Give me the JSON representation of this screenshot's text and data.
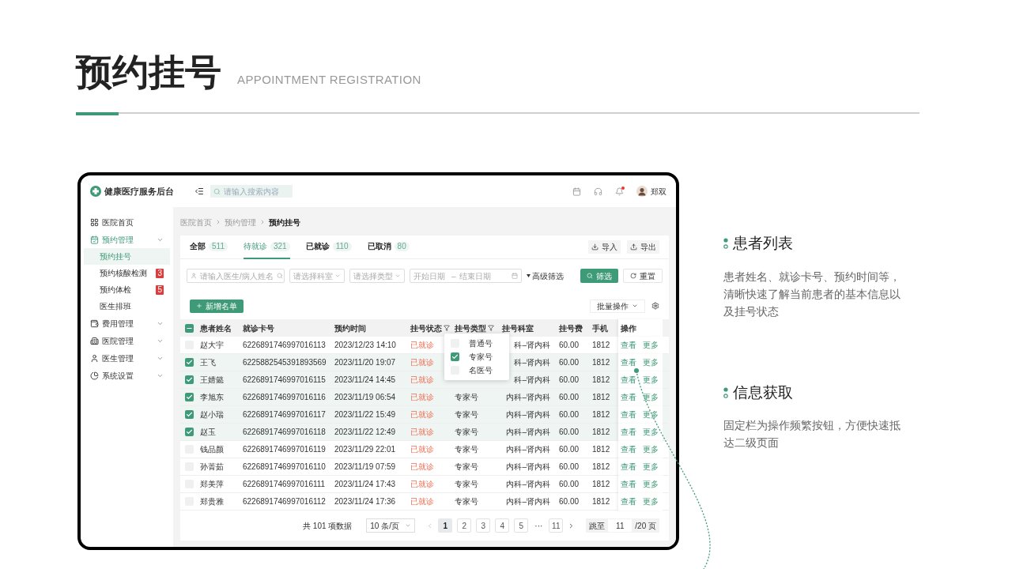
{
  "slide": {
    "title": "预约挂号",
    "subtitle": "APPOINTMENT REGISTRATION"
  },
  "app": {
    "brand": "健康医疗服务后台",
    "search_placeholder": "请输入搜索内容",
    "user": "郑双",
    "notification": true,
    "sidebar": [
      {
        "label": "医院首页",
        "selected": false,
        "expandable": false
      },
      {
        "label": "预约管理",
        "selected": true,
        "expandable": true,
        "children": [
          {
            "label": "预约挂号",
            "selected": true
          },
          {
            "label": "预约核酸检测",
            "selected": false,
            "badge": "3"
          },
          {
            "label": "预约体检",
            "selected": false,
            "badge": "5"
          },
          {
            "label": "医生排班",
            "selected": false
          }
        ]
      },
      {
        "label": "费用管理",
        "selected": false,
        "expandable": true
      },
      {
        "label": "医院管理",
        "selected": false,
        "expandable": true
      },
      {
        "label": "医生管理",
        "selected": false,
        "expandable": true
      },
      {
        "label": "系统设置",
        "selected": false,
        "expandable": true
      }
    ],
    "breadcrumb": [
      "医院首页",
      "预约管理",
      "预约挂号"
    ],
    "tabs": [
      {
        "label": "全部",
        "count": "511",
        "selected": false
      },
      {
        "label": "待就诊",
        "count": "321",
        "selected": true
      },
      {
        "label": "已就诊",
        "count": "110",
        "selected": false
      },
      {
        "label": "已取消",
        "count": "80",
        "selected": false
      }
    ],
    "actions": [
      {
        "label": "导入",
        "kind": "import"
      },
      {
        "label": "导出",
        "kind": "export"
      }
    ],
    "filters": {
      "name_placeholder": "请输入医生/病人姓名",
      "dept_placeholder": "请选择科室",
      "type_placeholder": "请选择类型",
      "start_placeholder": "开始日期",
      "range_separator": "–",
      "end_placeholder": "结束日期",
      "advanced": "高级筛选",
      "search": "筛选",
      "reset": "重置"
    },
    "add_button": "新增名单",
    "batch": "批量操作",
    "table": {
      "select_all_partial": true,
      "columns": [
        {
          "label": "患者姓名",
          "filter": false
        },
        {
          "label": "就诊卡号",
          "filter": false
        },
        {
          "label": "预约时间",
          "filter": false
        },
        {
          "label": "挂号状态",
          "filter": true
        },
        {
          "label": "挂号类型",
          "filter": true
        },
        {
          "label": "挂号科室",
          "filter": false
        },
        {
          "label": "挂号费",
          "filter": false
        },
        {
          "label": "手机",
          "filter": false
        },
        {
          "label": "操作",
          "filter": false
        }
      ],
      "rows": [
        {
          "checked": false,
          "name": "赵大宇",
          "card": "6226891746997016113",
          "time": "2023/12/23 14:10",
          "status": "已就诊",
          "dept": "科–肾内科",
          "fee": "60.00",
          "phone": "1812",
          "actions": [
            "查看",
            "更多"
          ]
        },
        {
          "checked": true,
          "name": "王飞",
          "card": "6225882545391893569",
          "time": "2023/11/20 19:07",
          "status": "已就诊",
          "dept": "科–肾内科",
          "fee": "60.00",
          "phone": "1812",
          "actions": [
            "查看",
            "更多"
          ]
        },
        {
          "checked": true,
          "name": "王婧懿",
          "card": "6226891746997016115",
          "time": "2023/11/24 14:45",
          "status": "已就诊",
          "dept": "科–肾内科",
          "fee": "60.00",
          "phone": "1812",
          "actions": [
            "查看",
            "更多"
          ]
        },
        {
          "checked": true,
          "name": "李旭东",
          "card": "6226891746997016116",
          "time": "2023/11/19 06:54",
          "status": "已就诊",
          "type": "专家号",
          "dept": "内科–肾内科",
          "fee": "60.00",
          "phone": "1812",
          "actions": [
            "查看",
            "更多"
          ]
        },
        {
          "checked": true,
          "name": "赵小瑞",
          "card": "6226891746997016117",
          "time": "2023/11/22 15:49",
          "status": "已就诊",
          "type": "专家号",
          "dept": "内科–肾内科",
          "fee": "60.00",
          "phone": "1812",
          "actions": [
            "查看",
            "更多"
          ]
        },
        {
          "checked": true,
          "name": "赵玉",
          "card": "6226891746997016118",
          "time": "2023/11/22 12:49",
          "status": "已就诊",
          "type": "专家号",
          "dept": "内科–肾内科",
          "fee": "60.00",
          "phone": "1812",
          "actions": [
            "查看",
            "更多"
          ]
        },
        {
          "checked": false,
          "name": "钱品颜",
          "card": "6226891746997016119",
          "time": "2023/11/29 22:01",
          "status": "已就诊",
          "type": "专家号",
          "dept": "内科–肾内科",
          "fee": "60.00",
          "phone": "1812",
          "actions": [
            "查看",
            "更多"
          ]
        },
        {
          "checked": false,
          "name": "孙菁茹",
          "card": "6226891746997016110",
          "time": "2023/11/19 07:59",
          "status": "已就诊",
          "type": "专家号",
          "dept": "内科–肾内科",
          "fee": "60.00",
          "phone": "1812",
          "actions": [
            "查看",
            "更多"
          ]
        },
        {
          "checked": false,
          "name": "郑美萍",
          "card": "6226891746997016111",
          "time": "2023/11/24 17:43",
          "status": "已就诊",
          "type": "专家号",
          "dept": "内科–肾内科",
          "fee": "60.00",
          "phone": "1812",
          "actions": [
            "查看",
            "更多"
          ]
        },
        {
          "checked": false,
          "name": "郑贵雅",
          "card": "6226891746997016112",
          "time": "2023/11/24 17:36",
          "status": "已就诊",
          "type": "专家号",
          "dept": "内科–肾内科",
          "fee": "60.00",
          "phone": "1812",
          "actions": [
            "查看",
            "更多"
          ]
        }
      ]
    },
    "filter_menu": [
      {
        "label": "普通号",
        "checked": false
      },
      {
        "label": "专家号",
        "checked": true
      },
      {
        "label": "名医号",
        "checked": false
      }
    ],
    "pagination": {
      "total": "共 101 项数据",
      "page_size": "10 条/页",
      "pages": [
        {
          "label": "1",
          "selected": true
        },
        {
          "label": "2",
          "selected": false
        },
        {
          "label": "3",
          "selected": false
        },
        {
          "label": "4",
          "selected": false
        },
        {
          "label": "5",
          "selected": false
        },
        {
          "label": "···",
          "kind": "ellipsis"
        },
        {
          "label": "11",
          "selected": false
        }
      ],
      "jump_label": "跳至",
      "jump_value": "11",
      "total_pages": "/20 页"
    }
  },
  "annotations": [
    {
      "title": "患者列表",
      "text": "患者姓名、就诊卡号、预约时间等，清晰快速了解当前患者的基本信息以及挂号状态"
    },
    {
      "title": "信息获取",
      "text": "固定栏为操作频繁按钮，方便快速抵达二级页面"
    }
  ]
}
